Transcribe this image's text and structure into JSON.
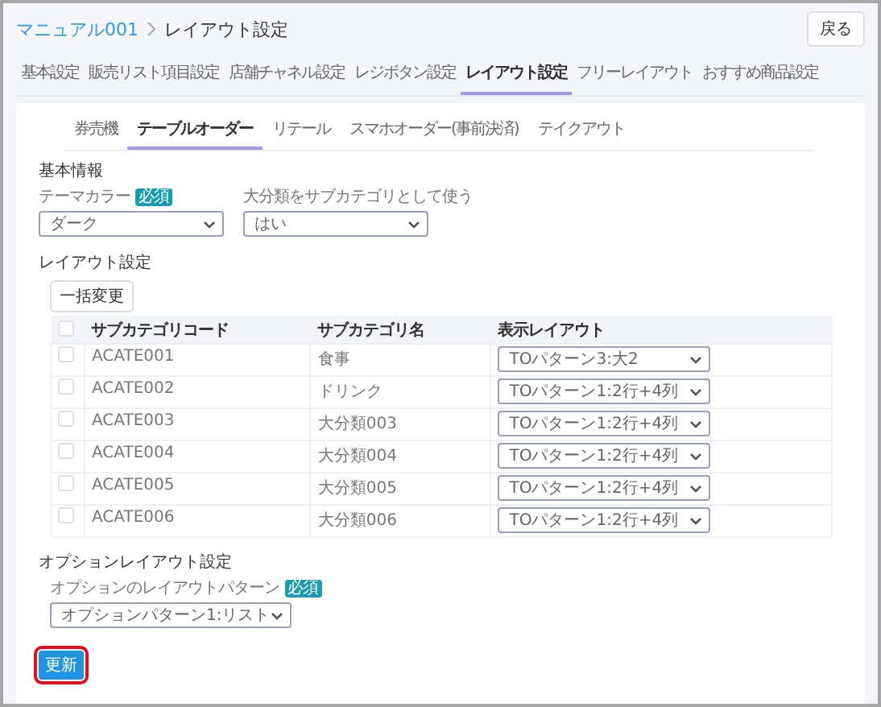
{
  "breadcrumb": {
    "parent": "マニュアル001",
    "current": "レイアウト設定"
  },
  "back_button": "戻る",
  "tabs": [
    {
      "label": "基本設定",
      "selected": false
    },
    {
      "label": "販売リスト項目設定",
      "selected": false
    },
    {
      "label": "店舗チャネル設定",
      "selected": false
    },
    {
      "label": "レジボタン設定",
      "selected": false
    },
    {
      "label": "レイアウト設定",
      "selected": true
    },
    {
      "label": "フリーレイアウト",
      "selected": false
    },
    {
      "label": "おすすめ商品設定",
      "selected": false
    }
  ],
  "sub_tabs": [
    {
      "label": "券売機",
      "selected": false
    },
    {
      "label": "テーブルオーダー",
      "selected": true
    },
    {
      "label": "リテール",
      "selected": false
    },
    {
      "label": "スマホオーダー(事前決済)",
      "selected": false
    },
    {
      "label": "テイクアウト",
      "selected": false
    }
  ],
  "basic_info": {
    "heading": "基本情報",
    "fields": [
      {
        "label": "テーマカラー",
        "required": true,
        "required_badge": "必須",
        "value": "ダーク"
      },
      {
        "label": "大分類をサブカテゴリとして使う",
        "required": false,
        "value": "はい"
      }
    ]
  },
  "layout": {
    "heading": "レイアウト設定",
    "bulk_button": "一括変更",
    "columns": [
      "サブカテゴリコード",
      "サブカテゴリ名",
      "表示レイアウト"
    ],
    "header_checked": false,
    "rows": [
      {
        "checked": false,
        "code": "ACATE001",
        "name": "食事",
        "layout": "TOパターン3:大2"
      },
      {
        "checked": false,
        "code": "ACATE002",
        "name": "ドリンク",
        "layout": "TOパターン1:2行+4列"
      },
      {
        "checked": false,
        "code": "ACATE003",
        "name": "大分類003",
        "layout": "TOパターン1:2行+4列"
      },
      {
        "checked": false,
        "code": "ACATE004",
        "name": "大分類004",
        "layout": "TOパターン1:2行+4列"
      },
      {
        "checked": false,
        "code": "ACATE005",
        "name": "大分類005",
        "layout": "TOパターン1:2行+4列"
      },
      {
        "checked": false,
        "code": "ACATE006",
        "name": "大分類006",
        "layout": "TOパターン1:2行+4列"
      }
    ]
  },
  "option_layout": {
    "heading": "オプションレイアウト設定",
    "field": {
      "label": "オプションのレイアウトパターン",
      "required": true,
      "required_badge": "必須",
      "value": "オプションパターン1:リスト"
    }
  },
  "update_button": {
    "label": "更新",
    "highlighted": true
  }
}
